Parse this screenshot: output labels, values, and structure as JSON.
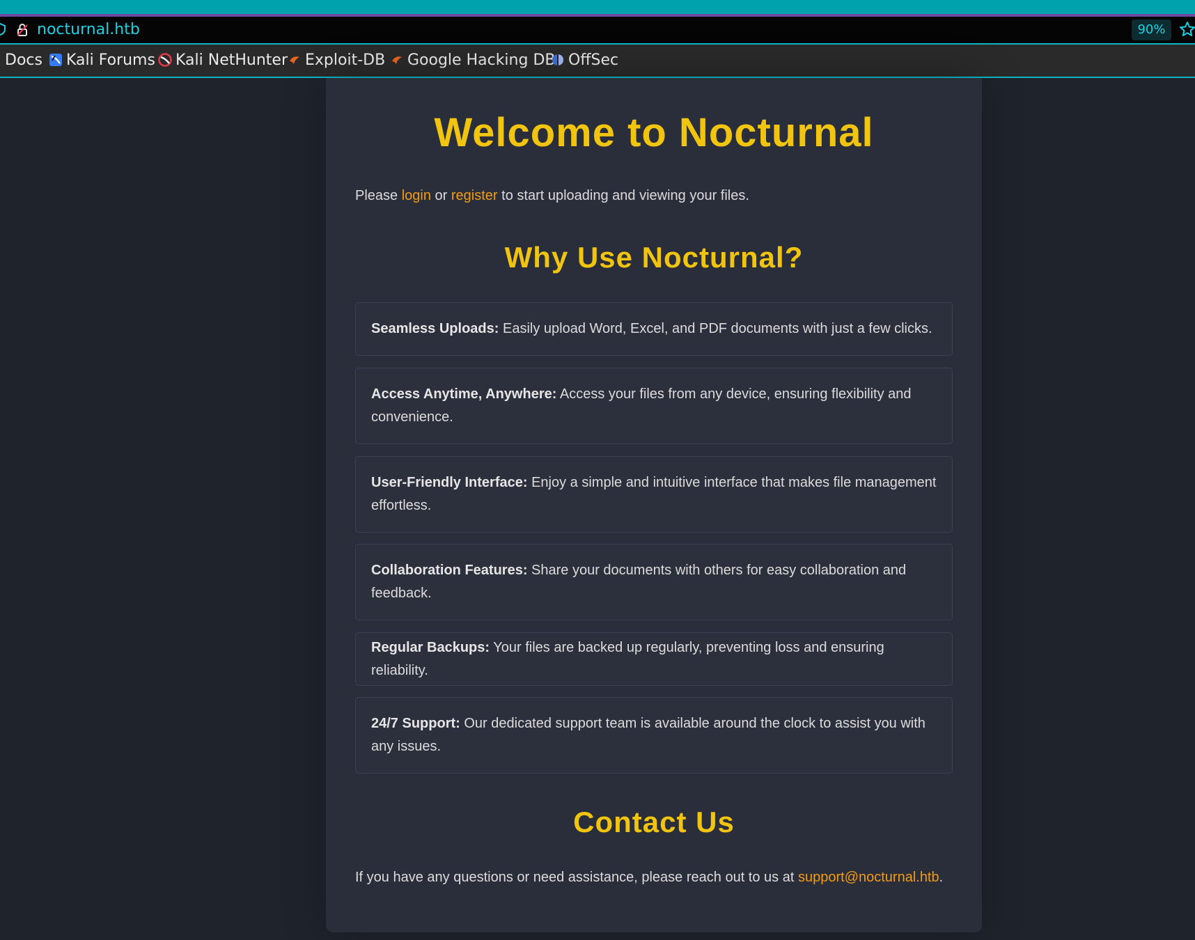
{
  "browser": {
    "url": "nocturnal.htb",
    "zoom": "90%",
    "bookmarks": [
      {
        "label": "Docs"
      },
      {
        "label": "Kali Forums"
      },
      {
        "label": "Kali NetHunter"
      },
      {
        "label": "Exploit-DB"
      },
      {
        "label": "Google Hacking DB"
      },
      {
        "label": "OffSec"
      }
    ]
  },
  "page": {
    "title": "Welcome to Nocturnal",
    "intro": {
      "prefix": "Please ",
      "login": "login",
      "middle": " or ",
      "register": "register",
      "suffix": " to start uploading and viewing your files."
    },
    "why_heading": "Why Use Nocturnal?",
    "features": [
      {
        "title": "Seamless Uploads:",
        "text": " Easily upload Word, Excel, and PDF documents with just a few clicks."
      },
      {
        "title": "Access Anytime, Anywhere:",
        "text": " Access your files from any device, ensuring flexibility and convenience."
      },
      {
        "title": "User-Friendly Interface:",
        "text": " Enjoy a simple and intuitive interface that makes file management effortless."
      },
      {
        "title": "Collaboration Features:",
        "text": " Share your documents with others for easy collaboration and feedback."
      },
      {
        "title": "Regular Backups:",
        "text": " Your files are backed up regularly, preventing loss and ensuring reliability."
      },
      {
        "title": "24/7 Support:",
        "text": " Our dedicated support team is available around the clock to assist you with any issues."
      }
    ],
    "contact_heading": "Contact Us",
    "contact": {
      "prefix": "If you have any questions or need assistance, please reach out to us at ",
      "email": "support@nocturnal.htb",
      "suffix": "."
    }
  },
  "colors": {
    "accent_yellow": "#f1c40f",
    "link_orange": "#f39c12",
    "chrome_cyan": "#19d3e3"
  }
}
